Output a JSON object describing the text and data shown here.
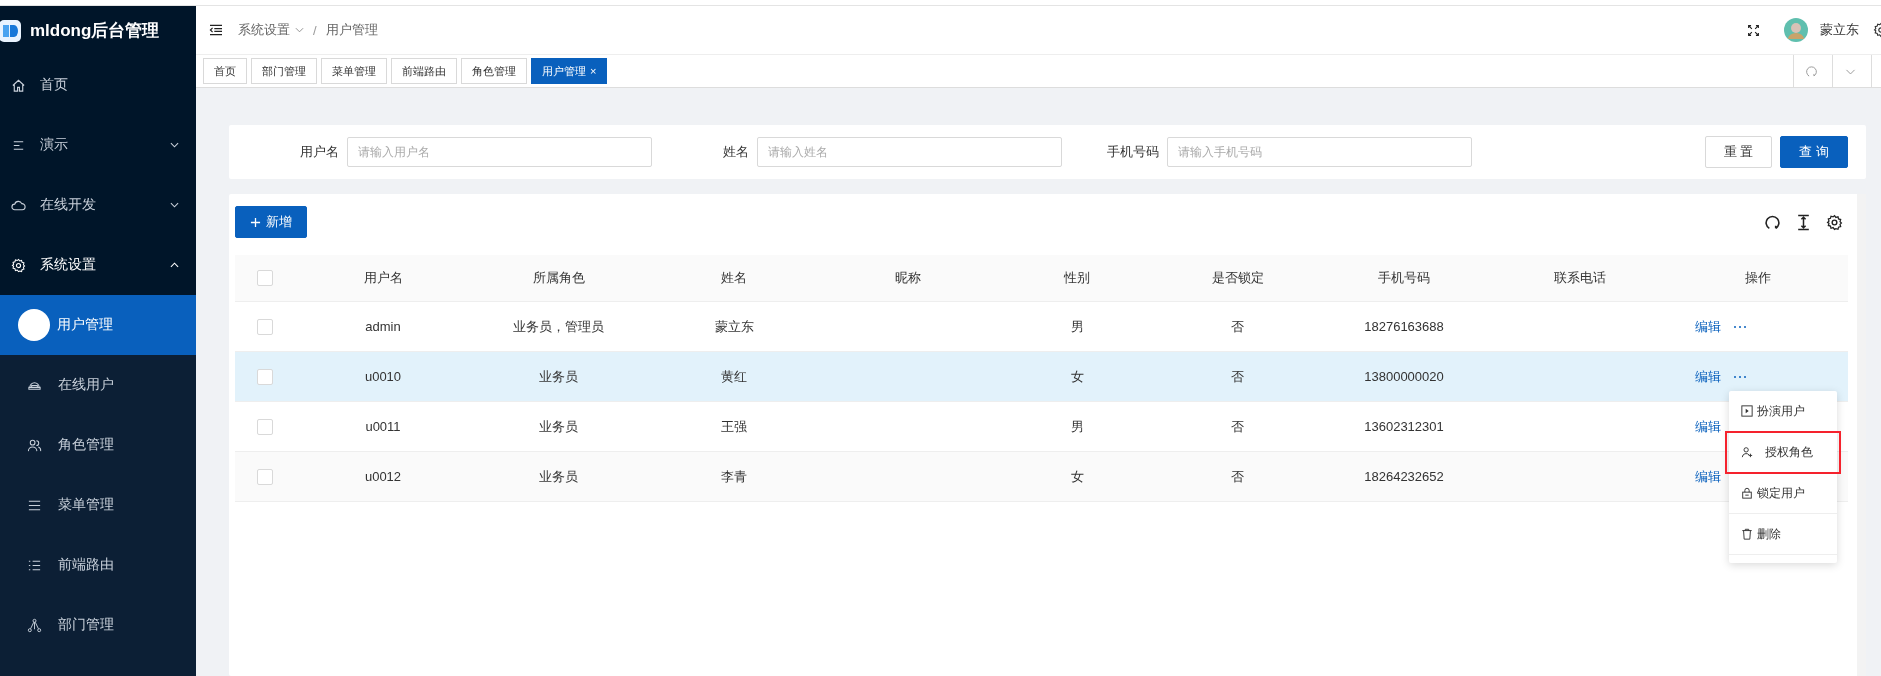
{
  "app": {
    "title": "mldong后台管理"
  },
  "sidebar": {
    "items": [
      {
        "label": "首页"
      },
      {
        "label": "演示",
        "expanded": false
      },
      {
        "label": "在线开发",
        "expanded": false
      },
      {
        "label": "系统设置",
        "expanded": true,
        "children": [
          {
            "label": "用户管理",
            "selected": true
          },
          {
            "label": "在线用户",
            "selected": false
          },
          {
            "label": "角色管理",
            "selected": false
          },
          {
            "label": "菜单管理",
            "selected": false
          },
          {
            "label": "前端路由",
            "selected": false
          },
          {
            "label": "部门管理",
            "selected": false
          }
        ]
      }
    ]
  },
  "header": {
    "breadcrumb": [
      "系统设置",
      "用户管理"
    ],
    "separator": "/",
    "user": "蒙立东"
  },
  "tabs": [
    {
      "label": "首页",
      "selected": false
    },
    {
      "label": "部门管理",
      "selected": false
    },
    {
      "label": "菜单管理",
      "selected": false
    },
    {
      "label": "前端路由",
      "selected": false
    },
    {
      "label": "角色管理",
      "selected": false
    },
    {
      "label": "用户管理",
      "selected": true,
      "close": "×"
    }
  ],
  "search": {
    "fields": [
      {
        "label": "用户名",
        "placeholder": "请输入用户名"
      },
      {
        "label": "姓名",
        "placeholder": "请输入姓名"
      },
      {
        "label": "手机号码",
        "placeholder": "请输入手机号码"
      }
    ],
    "reset": "重 置",
    "query": "查 询"
  },
  "table": {
    "add_button": "新增",
    "header_checked": false,
    "columns": [
      "用户名",
      "所属角色",
      "姓名",
      "昵称",
      "性别",
      "是否锁定",
      "手机号码",
      "联系电话",
      "操作"
    ],
    "rows": [
      {
        "checked": false,
        "selected": false,
        "cells": [
          "admin",
          "业务员，管理员",
          "蒙立东",
          "",
          "男",
          "否",
          "18276163688",
          ""
        ],
        "edit": "编辑"
      },
      {
        "checked": false,
        "selected": true,
        "cells": [
          "u0010",
          "业务员",
          "黄红",
          "",
          "女",
          "否",
          "13800000020",
          ""
        ],
        "edit": "编辑"
      },
      {
        "checked": false,
        "selected": false,
        "cells": [
          "u0011",
          "业务员",
          "王强",
          "",
          "男",
          "否",
          "13602312301",
          ""
        ],
        "edit": "编辑"
      },
      {
        "checked": false,
        "selected": false,
        "cells": [
          "u0012",
          "业务员",
          "李青",
          "",
          "女",
          "否",
          "18264232652",
          ""
        ],
        "edit": "编辑"
      }
    ]
  },
  "row_menu": {
    "items": [
      {
        "label": "扮演用户",
        "highlighted": false
      },
      {
        "label": "授权角色",
        "highlighted": true
      },
      {
        "label": "锁定用户",
        "highlighted": false
      },
      {
        "label": "删除",
        "highlighted": false
      }
    ]
  }
}
